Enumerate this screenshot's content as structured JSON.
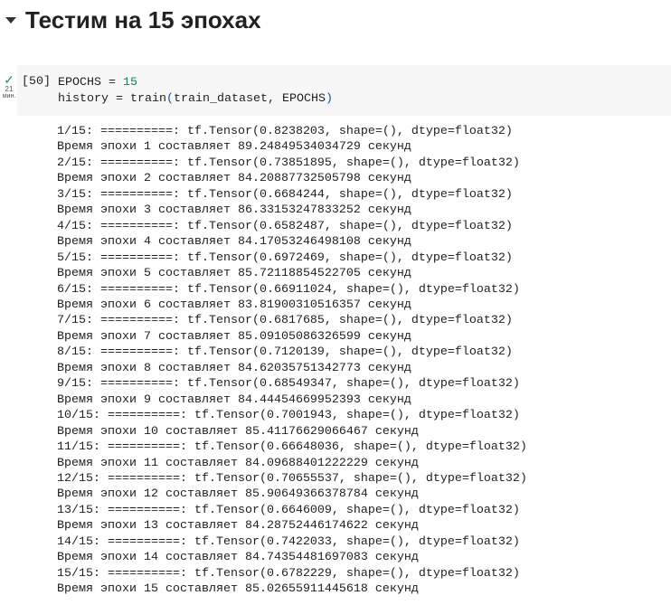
{
  "section": {
    "title": "Тестим на 15 эпохах"
  },
  "cell": {
    "status": {
      "time_value": "21",
      "time_unit": "мин."
    },
    "exec_count": "[50]",
    "code": {
      "line1_prefix": "EPOCHS = ",
      "line1_number": "15",
      "line2_a": "history = train",
      "line2_open": "(",
      "line2_args": "train_dataset, EPOCHS",
      "line2_close": ")"
    }
  },
  "output": {
    "lines": [
      "1/15: ==========: tf.Tensor(0.8238203, shape=(), dtype=float32)",
      "Время эпохи 1 составляет 89.24849534034729 секунд",
      "2/15: ==========: tf.Tensor(0.73851895, shape=(), dtype=float32)",
      "Время эпохи 2 составляет 84.20887732505798 секунд",
      "3/15: ==========: tf.Tensor(0.6684244, shape=(), dtype=float32)",
      "Время эпохи 3 составляет 86.33153247833252 секунд",
      "4/15: ==========: tf.Tensor(0.6582487, shape=(), dtype=float32)",
      "Время эпохи 4 составляет 84.17053246498108 секунд",
      "5/15: ==========: tf.Tensor(0.6972469, shape=(), dtype=float32)",
      "Время эпохи 5 составляет 85.72118854522705 секунд",
      "6/15: ==========: tf.Tensor(0.66911024, shape=(), dtype=float32)",
      "Время эпохи 6 составляет 83.81900310516357 секунд",
      "7/15: ==========: tf.Tensor(0.6817685, shape=(), dtype=float32)",
      "Время эпохи 7 составляет 85.09105086326599 секунд",
      "8/15: ==========: tf.Tensor(0.7120139, shape=(), dtype=float32)",
      "Время эпохи 8 составляет 84.62035751342773 секунд",
      "9/15: ==========: tf.Tensor(0.68549347, shape=(), dtype=float32)",
      "Время эпохи 9 составляет 84.44454669952393 секунд",
      "10/15: ==========: tf.Tensor(0.7001943, shape=(), dtype=float32)",
      "Время эпохи 10 составляет 85.41176629066467 секунд",
      "11/15: ==========: tf.Tensor(0.66648036, shape=(), dtype=float32)",
      "Время эпохи 11 составляет 84.09688401222229 секунд",
      "12/15: ==========: tf.Tensor(0.70655537, shape=(), dtype=float32)",
      "Время эпохи 12 составляет 85.90649366378784 секунд",
      "13/15: ==========: tf.Tensor(0.6646009, shape=(), dtype=float32)",
      "Время эпохи 13 составляет 84.28752446174622 секунд",
      "14/15: ==========: tf.Tensor(0.7422033, shape=(), dtype=float32)",
      "Время эпохи 14 составляет 84.74354481697083 секунд",
      "15/15: ==========: tf.Tensor(0.6782229, shape=(), dtype=float32)",
      "Время эпохи 15 составляет 85.02655911445618 секунд"
    ]
  }
}
